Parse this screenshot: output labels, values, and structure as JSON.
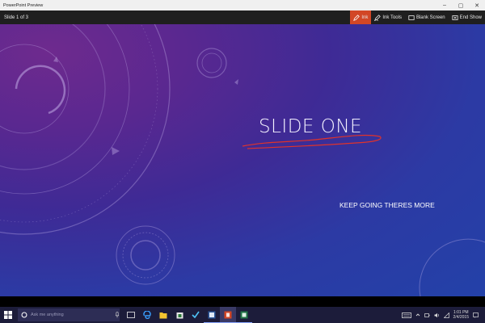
{
  "window": {
    "title": "PowerPoint Preview",
    "minimize": "–",
    "maximize": "▢",
    "close": "✕"
  },
  "toolbar": {
    "slide_counter": "Slide 1 of 3",
    "buttons": [
      {
        "label": "Ink",
        "icon": "pen-icon",
        "active": true
      },
      {
        "label": "Ink Tools",
        "icon": "ink-tools-icon"
      },
      {
        "label": "Blank Screen",
        "icon": "blank-screen-icon"
      },
      {
        "label": "End Show",
        "icon": "end-show-icon"
      }
    ],
    "active_color": "#d24726"
  },
  "slide": {
    "title": "SLIDE ONE",
    "body": "KEEP GOING THERES MORE",
    "ink_color": "#e0332b"
  },
  "taskbar": {
    "search_placeholder": "Ask me anything",
    "apps": [
      "task-view-icon",
      "edge-icon",
      "file-explorer-icon",
      "store-icon",
      "visual-studio-icon",
      "word-icon",
      "powerpoint-icon",
      "excel-icon"
    ],
    "clock_time": "1:01 PM",
    "clock_date": "2/4/2015"
  }
}
